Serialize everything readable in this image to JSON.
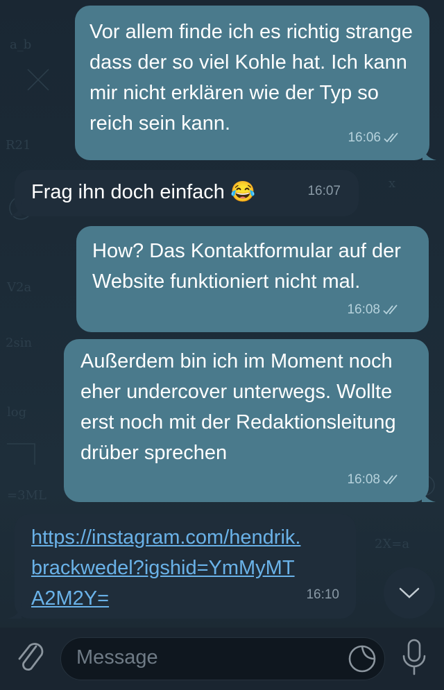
{
  "messages": [
    {
      "direction": "out",
      "text": "Vor allem finde ich es richtig strange dass der so viel Kohle hat. Ich kann mir nicht erklären wie der Typ so reich sein kann.",
      "time": "16:06",
      "read": true
    },
    {
      "direction": "in",
      "text": "Frag ihn doch einfach 😂",
      "time": "16:07"
    },
    {
      "direction": "out",
      "text": "How? Das Kontaktformular auf der Website funktioniert nicht mal.",
      "time": "16:08",
      "read": true
    },
    {
      "direction": "out",
      "text": "Außerdem bin ich im Moment noch eher undercover unterwegs. Wollte erst noch mit der Redaktionsleitung drüber sprechen",
      "time": "16:08",
      "read": true
    },
    {
      "direction": "in",
      "text": "https://instagram.com/hendrik.brackwedel?igshid=YmMyMTA2M2Y=",
      "time": "16:10",
      "is_link": true
    }
  ],
  "composer": {
    "placeholder": "Message"
  },
  "icons": {
    "attach": "paperclip-icon",
    "sticker": "sticker-icon",
    "mic": "microphone-icon",
    "scroll": "chevron-down-icon",
    "read_status": "double-check-icon"
  },
  "colors": {
    "outgoing_bubble": "#4a7a8c",
    "incoming_bubble": "#1f2d3a",
    "link": "#6ab2e8",
    "background": "#1c2b37"
  }
}
